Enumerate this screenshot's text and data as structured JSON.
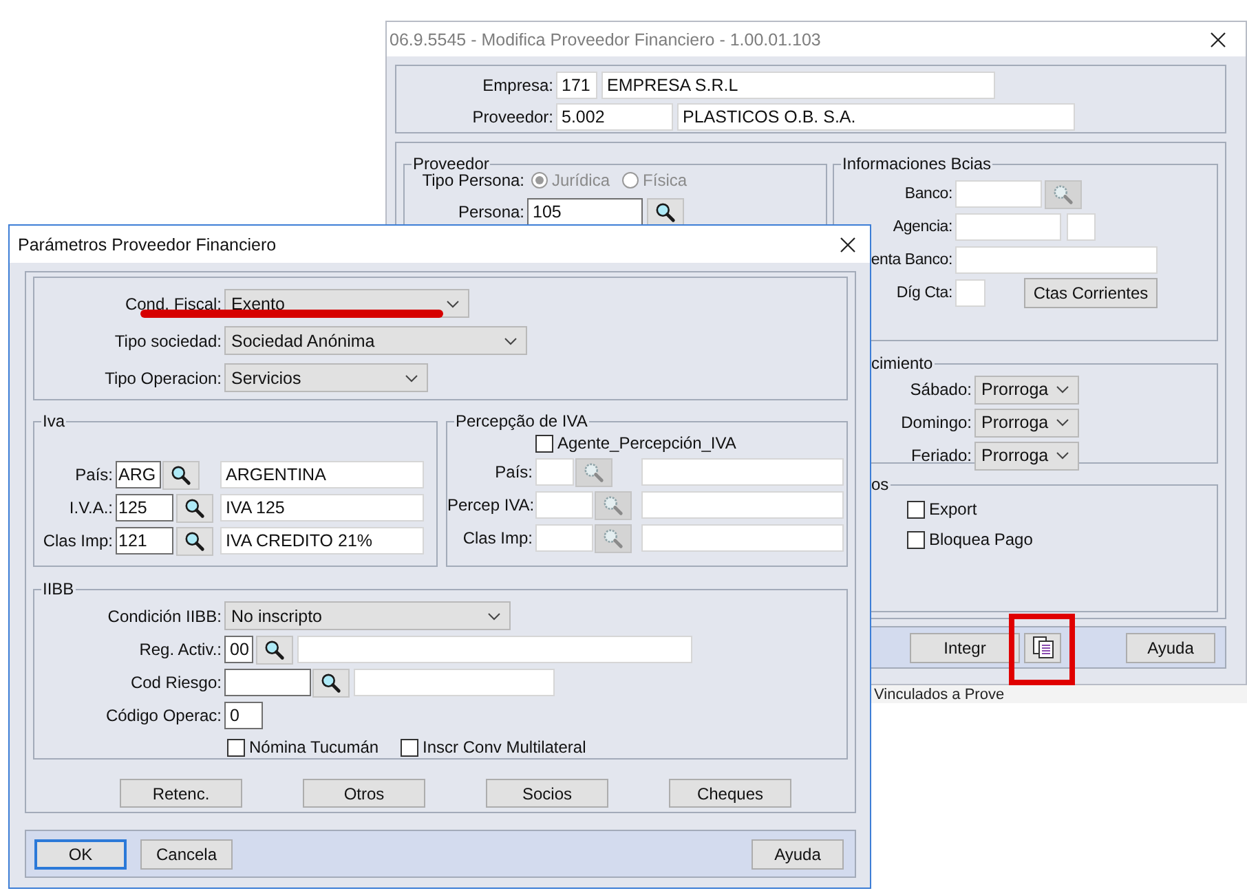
{
  "back_window": {
    "title": "06.9.5545 - Modifica Proveedor Financiero - 1.00.01.103",
    "empresa": {
      "label": "Empresa:",
      "code": "171",
      "name": "EMPRESA  S.R.L"
    },
    "proveedor": {
      "label": "Proveedor:",
      "code": "5.002",
      "name": "PLASTICOS O.B.  S.A."
    },
    "proveedor_group": {
      "title": "Proveedor",
      "tipo_persona": {
        "label": "Tipo Persona:",
        "disabled": true,
        "options": [
          {
            "label": "Jurídica",
            "selected": true
          },
          {
            "label": "Física",
            "selected": false
          }
        ]
      },
      "persona": {
        "label": "Persona:",
        "value": "105"
      }
    },
    "bancos_group": {
      "title": "Informaciones Bcias",
      "banco_label": "Banco:",
      "agencia_label": "Agencia:",
      "cuenta_label": "enta Banco:",
      "dig_label": "Díg Cta:",
      "ctas_button": "Ctas Corrientes"
    },
    "vencimiento_group": {
      "title": "cimiento",
      "rows": [
        {
          "label": "Sábado:",
          "value": "Prorroga"
        },
        {
          "label": "Domingo:",
          "value": "Prorroga"
        },
        {
          "label": "Feriado:",
          "value": "Prorroga"
        }
      ]
    },
    "otros_group": {
      "title": "os",
      "checks": [
        {
          "label": "Export",
          "checked": false
        },
        {
          "label": "Bloquea Pago",
          "checked": false
        }
      ]
    },
    "buttons": {
      "integr": "Integr",
      "ayuda": "Ayuda"
    }
  },
  "background": {
    "fragment": "Vinculados a Prove"
  },
  "front_window": {
    "title": "Parámetros Proveedor Financiero",
    "top_fields": [
      {
        "label": "Cond. Fiscal:",
        "value": "Exento"
      },
      {
        "label": "Tipo sociedad:",
        "value": "Sociedad Anónima"
      },
      {
        "label": "Tipo Operacion:",
        "value": "Servicios"
      }
    ],
    "iva_group": {
      "title": "Iva",
      "rows": [
        {
          "label": "País:",
          "code": "ARG",
          "name": "ARGENTINA"
        },
        {
          "label": "I.V.A.:",
          "code": "125",
          "name": "IVA 125"
        },
        {
          "label": "Clas Imp:",
          "code": "121",
          "name": "IVA CREDITO 21%"
        }
      ]
    },
    "percepcion_group": {
      "title": "Percepção de IVA",
      "lookup_disabled": true,
      "agente": {
        "label": "Agente_Percepción_IVA",
        "checked": false
      },
      "rows": [
        {
          "label": "País:"
        },
        {
          "label": "Percep IVA:"
        },
        {
          "label": "Clas Imp:"
        }
      ]
    },
    "iibb_group": {
      "title": "IIBB",
      "condicion": {
        "label": "Condición IIBB:",
        "value": "No inscripto"
      },
      "reg_activ": {
        "label": "Reg. Activ.:",
        "code": "00"
      },
      "cod_riesgo": {
        "label": "Cod Riesgo:"
      },
      "codigo_operac": {
        "label": "Código Operac:",
        "value": "0"
      },
      "checks": [
        {
          "label": "Nómina Tucumán",
          "checked": false
        },
        {
          "label": "Inscr Conv Multilateral",
          "checked": false
        }
      ]
    },
    "action_buttons": [
      "Retenc.",
      "Otros",
      "Socios",
      "Cheques"
    ],
    "footer_buttons": [
      {
        "label": "OK",
        "focused": true
      },
      {
        "label": "Cancela",
        "focused": false
      },
      {
        "label": "Ayuda",
        "focused": false
      }
    ]
  }
}
